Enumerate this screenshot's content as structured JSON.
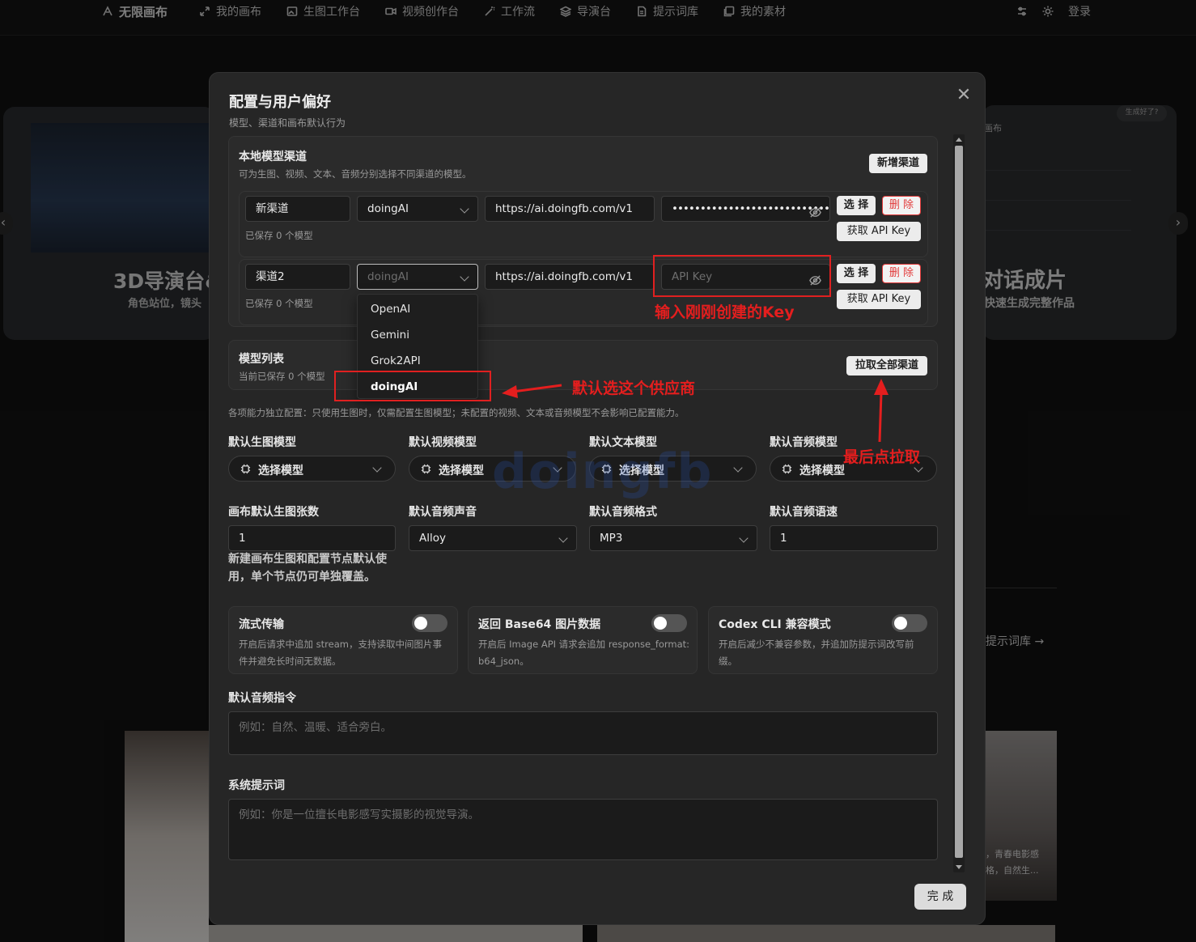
{
  "nav": {
    "brand": "无限画布",
    "items": [
      "我的画布",
      "生图工作台",
      "视频创作台",
      "工作流",
      "导演台",
      "提示词库",
      "我的素材"
    ],
    "login": "登录"
  },
  "background": {
    "left_title": "3D导演台&",
    "left_sub": "角色站位，镜头",
    "right_label": "画布",
    "right_badge": "生成好了?",
    "right_title": "对话成片",
    "right_sub": "快速生成完整作品",
    "prompt_link": "提示词库 →",
    "caption_1": "，青春电影感",
    "caption_2": "格，自然生..."
  },
  "modal": {
    "title": "配置与用户偏好",
    "subtitle": "模型、渠道和画布默认行为",
    "close_icon": "close-icon",
    "channels": {
      "title": "本地模型渠道",
      "subtitle": "可为生图、视频、文本、音频分别选择不同渠道的模型。",
      "add_button": "新增渠道",
      "rows": [
        {
          "name": "新渠道",
          "provider": "doingAI",
          "url": "https://ai.doingfb.com/v1",
          "key": "••••••••••••••••••••••••••••••••",
          "saved": "已保存 0 个模型",
          "select": "选 择",
          "delete": "删 除",
          "get_key": "获取 API Key"
        },
        {
          "name": "渠道2",
          "provider": "doingAI",
          "url": "https://ai.doingfb.com/v1",
          "key_placeholder": "API Key",
          "saved": "已保存 0 个模型",
          "select": "选 择",
          "delete": "删 除",
          "get_key": "获取 API Key"
        }
      ],
      "dropdown_options": [
        "OpenAI",
        "Gemini",
        "Grok2API",
        "doingAI"
      ],
      "dropdown_selected": "doingAI"
    },
    "model_list": {
      "title": "模型列表",
      "subtitle": "当前已保存 0 个模型",
      "pull_button": "拉取全部渠道"
    },
    "note": "各项能力独立配置：只使用生图时，仅需配置生图模型；未配置的视频、文本或音频模型不会影响已配置能力。",
    "defaults": {
      "labels": [
        "默认生图模型",
        "默认视频模型",
        "默认文本模型",
        "默认音频模型"
      ],
      "select_label": "选择模型"
    },
    "settings": {
      "image_count_label": "画布默认生图张数",
      "image_count": "1",
      "voice_label": "默认音频声音",
      "voice": "Alloy",
      "format_label": "默认音频格式",
      "format": "MP3",
      "speed_label": "默认音频语速",
      "speed": "1",
      "helper": "新建画布生图和配置节点默认使用，单个节点仍可单独覆盖。"
    },
    "toggles": [
      {
        "title": "流式传输",
        "desc": "开启后请求中追加 stream，支持读取中间图片事件并避免长时间无数据。",
        "on": false
      },
      {
        "title": "返回 Base64 图片数据",
        "desc": "开启后 Image API 请求会追加 response_format: b64_json。",
        "on": false
      },
      {
        "title": "Codex CLI 兼容模式",
        "desc": "开启后减少不兼容参数，并追加防提示词改写前缀。",
        "on": false
      }
    ],
    "audio_instruction": {
      "label": "默认音频指令",
      "placeholder": "例如：自然、温暖、适合旁白。"
    },
    "system_prompt": {
      "label": "系统提示词",
      "placeholder": "例如：你是一位擅长电影感写实摄影的视觉导演。"
    },
    "done": "完 成"
  },
  "annotations": {
    "key_hint": "输入刚刚创建的Key",
    "provider_hint": "默认选这个供应商",
    "pull_hint": "最后点拉取",
    "color": "#e41e1e"
  },
  "watermark": "doingfb"
}
